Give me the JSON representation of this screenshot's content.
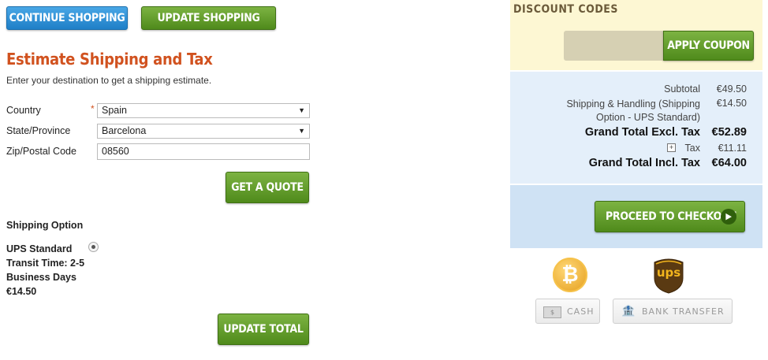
{
  "buttons": {
    "continue_shopping": "CONTINUE SHOPPING",
    "update_cart": "UPDATE SHOPPING CART",
    "get_quote": "GET A QUOTE",
    "update_total": "UPDATE TOTAL",
    "apply_coupon": "APPLY COUPON",
    "proceed_checkout": "PROCEED TO CHECKOUT"
  },
  "estimate": {
    "title": "Estimate Shipping and Tax",
    "subtitle": "Enter your destination to get a shipping estimate.",
    "country_label": "Country",
    "required_mark": "*",
    "country_value": "Spain",
    "state_label": "State/Province",
    "state_value": "Barcelona",
    "zip_label": "Zip/Postal Code",
    "zip_value": "08560",
    "shipping_option_label": "Shipping Option",
    "option_line1": "UPS Standard",
    "option_line2": "Transit Time: 2-5",
    "option_line3": "Business Days",
    "option_price": "€14.50"
  },
  "discount": {
    "title": "DISCOUNT CODES",
    "code_value": ""
  },
  "totals": {
    "subtotal_label": "Subtotal",
    "subtotal_value": "€49.50",
    "shipping_label_line1": "Shipping & Handling (Shipping",
    "shipping_label_line2": "Option - UPS Standard)",
    "shipping_value": "€14.50",
    "grand_excl_label": "Grand Total Excl. Tax",
    "grand_excl_value": "€52.89",
    "tax_label": "Tax",
    "tax_value": "€11.11",
    "grand_incl_label": "Grand Total Incl. Tax",
    "grand_incl_value": "€64.00"
  },
  "payment": {
    "cash_label": "CASH",
    "bank_label": "BANK TRANSFER",
    "ups_logo_text": "ups"
  },
  "colors": {
    "accent_orange": "#d1521f",
    "green_button": "#5b9a22",
    "blue_button": "#2b8ad3",
    "discount_bg": "#fdf7d3",
    "totals_bg": "#e4effa",
    "checkout_bg": "#cfe2f4"
  }
}
